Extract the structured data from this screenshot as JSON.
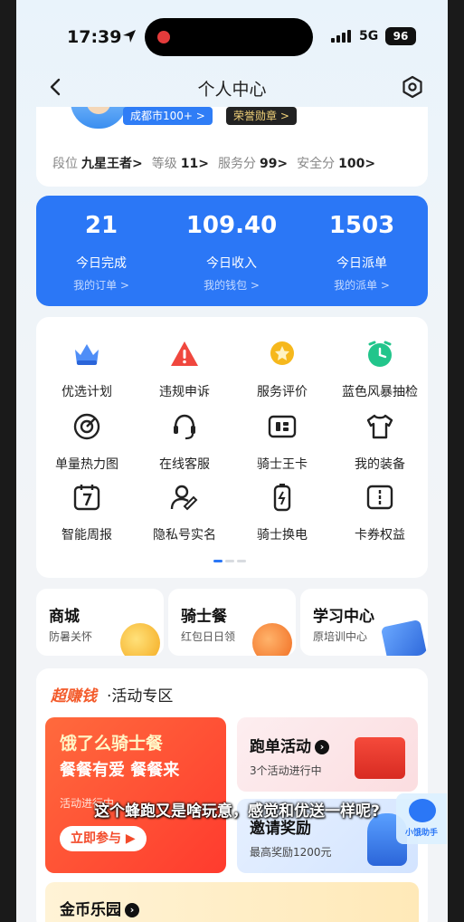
{
  "status": {
    "time": "17:39",
    "network": "5G",
    "battery": "96"
  },
  "nav": {
    "title": "个人中心"
  },
  "profile": {
    "city_badge": "成都市100+ >",
    "honor_badge": "荣誉勋章 >",
    "stats": [
      {
        "label": "段位",
        "value": "九星王者>"
      },
      {
        "label": "等级",
        "value": "11>"
      },
      {
        "label": "服务分",
        "value": "99>"
      },
      {
        "label": "安全分",
        "value": "100>"
      }
    ]
  },
  "summary": [
    {
      "value": "21",
      "label": "今日完成",
      "link": "我的订单 >"
    },
    {
      "value": "109.40",
      "label": "今日收入",
      "link": "我的钱包 >"
    },
    {
      "value": "1503",
      "label": "今日派单",
      "link": "我的派单 >"
    }
  ],
  "grid": [
    {
      "label": "优选计划",
      "icon": "crown-icon"
    },
    {
      "label": "违规申诉",
      "icon": "warning-icon"
    },
    {
      "label": "服务评价",
      "icon": "star-badge-icon"
    },
    {
      "label": "蓝色风暴抽检",
      "icon": "green-clock-icon"
    },
    {
      "label": "单量热力图",
      "icon": "target-icon"
    },
    {
      "label": "在线客服",
      "icon": "headset-icon"
    },
    {
      "label": "骑士王卡",
      "icon": "card-icon"
    },
    {
      "label": "我的装备",
      "icon": "tshirt-icon"
    },
    {
      "label": "智能周报",
      "icon": "calendar-icon"
    },
    {
      "label": "隐私号实名",
      "icon": "person-pen-icon"
    },
    {
      "label": "骑士换电",
      "icon": "battery-icon"
    },
    {
      "label": "卡券权益",
      "icon": "coupon-icon"
    }
  ],
  "shortcuts": [
    {
      "title": "商城",
      "subtitle": "防暑关怀"
    },
    {
      "title": "骑士餐",
      "subtitle": "红包日日领"
    },
    {
      "title": "学习中心",
      "subtitle": "原培训中心"
    }
  ],
  "activity": {
    "brand": "超赚钱",
    "title": "·活动专区",
    "promo": {
      "line1": "饿了么骑士餐",
      "line2": "餐餐有爱 餐餐来",
      "status": "活动进行中",
      "button": "立即参与 ▶"
    },
    "run": {
      "title": "跑单活动",
      "subtitle": "3个活动进行中"
    },
    "invite": {
      "title": "邀请奖励",
      "subtitle": "最高奖励1200元"
    },
    "coin": {
      "title": "金币乐园"
    }
  },
  "overlay": {
    "subtitle": "这个蜂跑又是啥玩意，感觉和优送一样呢?",
    "assistant_label": "小饿助手"
  },
  "colors": {
    "accent": "#2b77f6",
    "promo": "#ff4a2e"
  }
}
